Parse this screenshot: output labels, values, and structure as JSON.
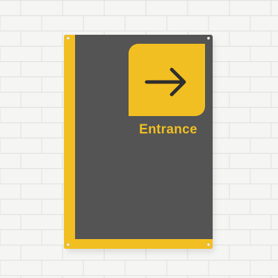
{
  "sign": {
    "label": "Entrance",
    "icon": "arrow-right-icon"
  },
  "colors": {
    "wall": "#f4f4f2",
    "panel": "#545454",
    "accent": "#f2bf22",
    "arrow": "#2e2e2e"
  }
}
